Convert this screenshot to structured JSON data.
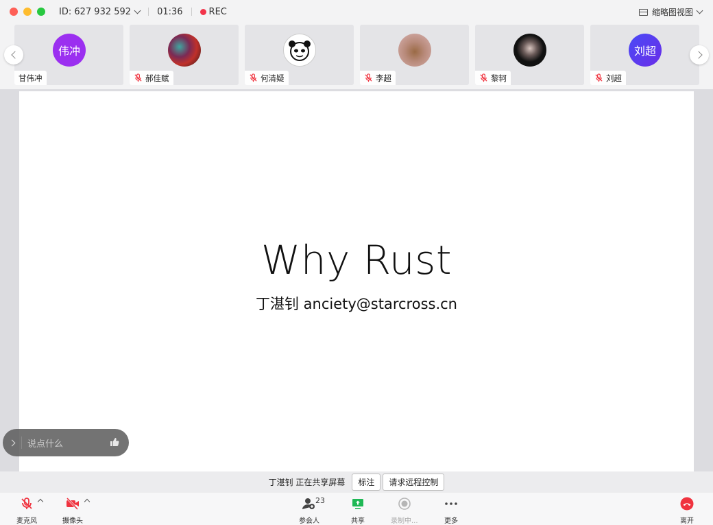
{
  "titlebar": {
    "meeting_id": "ID: 627 932 592",
    "timer": "01:36",
    "rec_label": "REC",
    "view_label": "缩略图视图"
  },
  "participants": [
    {
      "name": "甘伟冲",
      "avatar_text": "伟冲",
      "avatar_color": "#9b2ff0",
      "muted": false
    },
    {
      "name": "郝佳赋",
      "avatar_text": "",
      "avatar_color": "#8a2b2b",
      "muted": true
    },
    {
      "name": "何清疑",
      "avatar_text": "",
      "avatar_color": "#ffffff",
      "muted": true
    },
    {
      "name": "李超",
      "avatar_text": "",
      "avatar_color": "#c79a9a",
      "muted": true
    },
    {
      "name": "黎轲",
      "avatar_text": "",
      "avatar_color": "#1a1a1a",
      "muted": true
    },
    {
      "name": "刘超",
      "avatar_text": "刘超",
      "avatar_color": "#5b3cf0",
      "muted": true
    }
  ],
  "slide": {
    "title": "Why Rust",
    "subtitle": "丁湛钊 anciety@starcross.cn"
  },
  "chat": {
    "placeholder": "说点什么"
  },
  "sharebar": {
    "status": "丁湛钊 正在共享屏幕",
    "annotate_label": "标注",
    "remote_control_label": "请求远程控制"
  },
  "toolbar": {
    "mic_label": "麦克风",
    "camera_label": "摄像头",
    "participants_label": "参会人",
    "participants_count": "23",
    "share_label": "共享",
    "recording_label": "录制中...",
    "more_label": "更多",
    "leave_label": "离开"
  },
  "colors": {
    "accent_green": "#1fb855",
    "danger_red": "#f0333f",
    "rec_red": "#f2344a"
  }
}
